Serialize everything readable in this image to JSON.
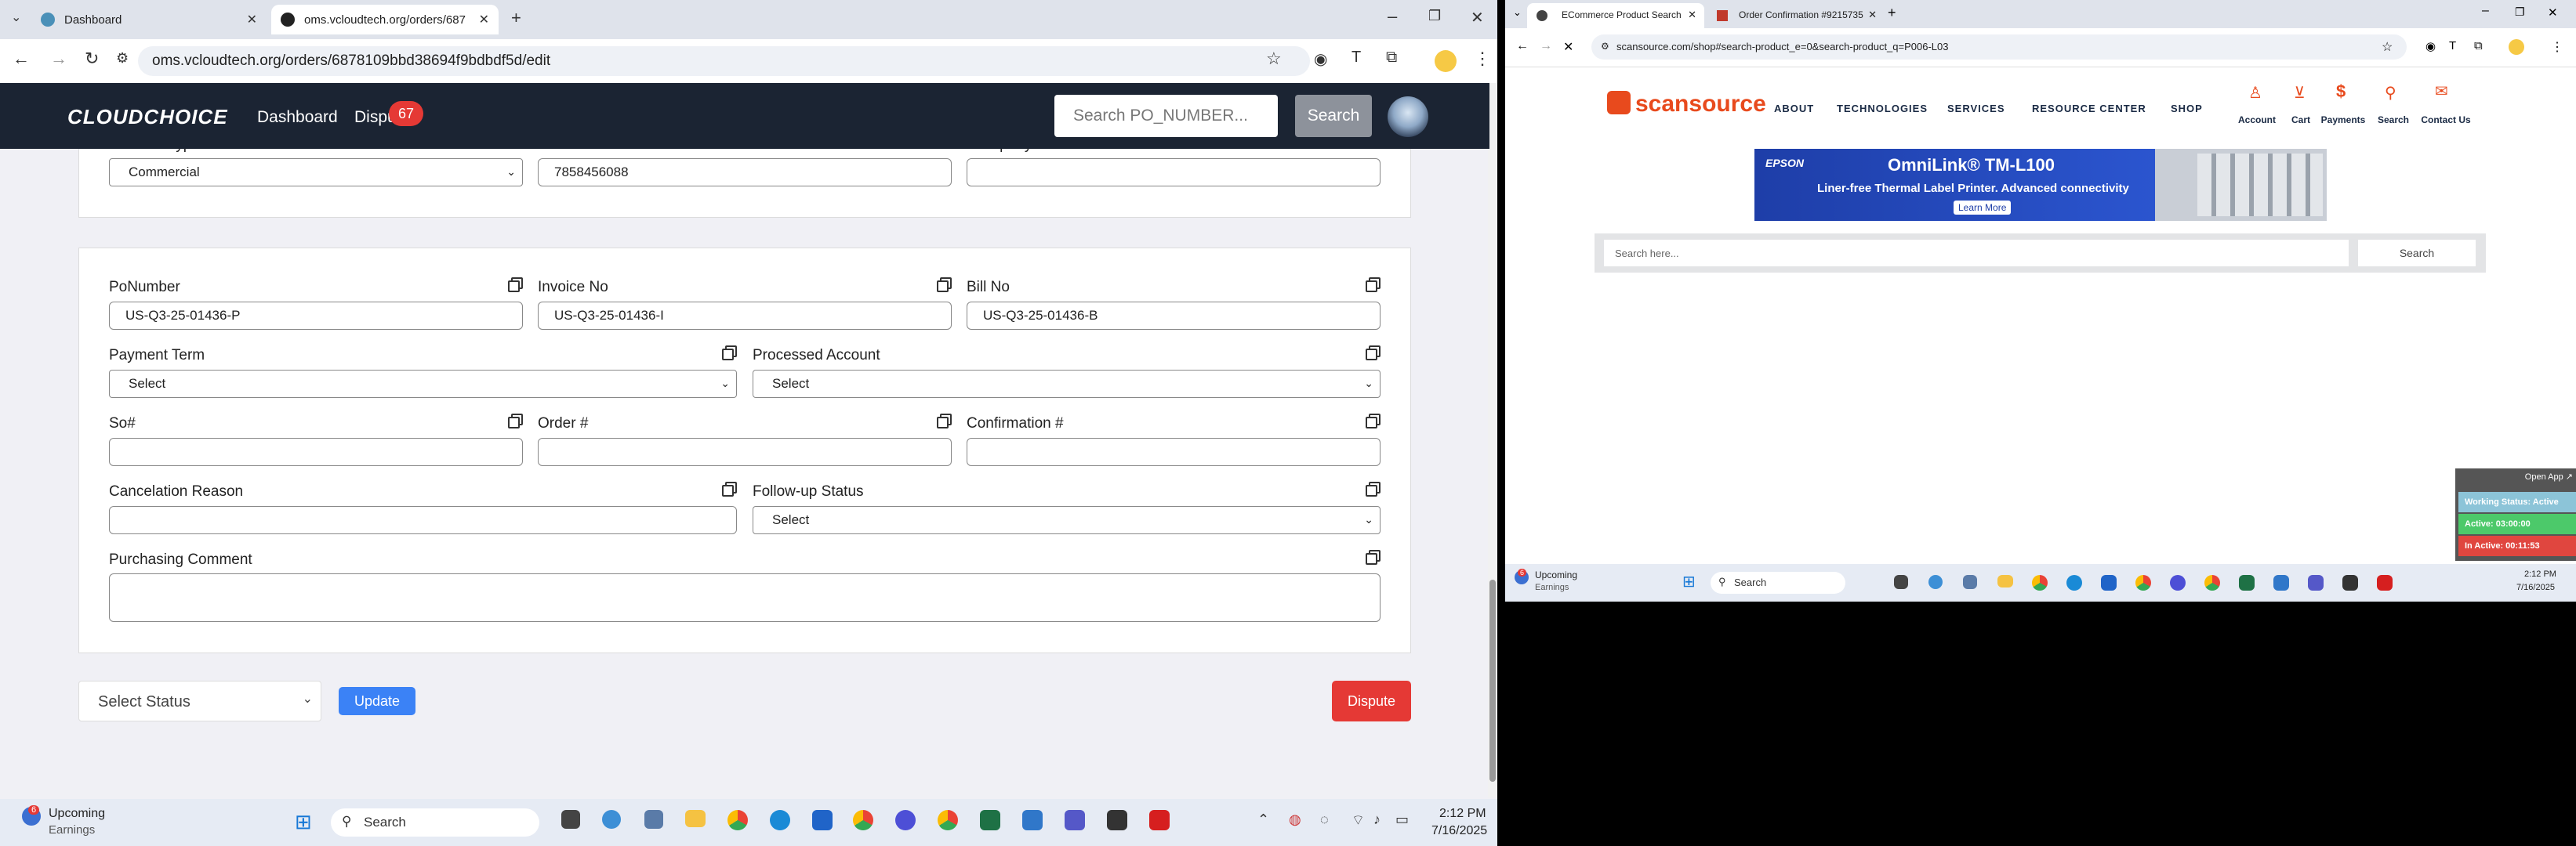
{
  "left_browser": {
    "tabs": [
      {
        "label": "Dashboard",
        "active": false
      },
      {
        "label": "oms.vcloudtech.org/orders/687",
        "active": true
      }
    ],
    "url": "oms.vcloudtech.org/orders/6878109bbd38694f9bdbdf5d/edit",
    "app": {
      "logo": "CLOUDCHOICE",
      "nav": [
        "Dashboard",
        "Dispu"
      ],
      "dispute_badge": "67",
      "search_placeholder": "Search PO_NUMBER...",
      "search_button": "Search"
    },
    "top_card": {
      "address_type_label": "Address Type",
      "address_type_value": "Commercial",
      "phone_label": "Phone Number",
      "phone_value": "7858456088",
      "company_phone_label": "Company Phone",
      "company_phone_value": ""
    },
    "form": {
      "po_label": "PoNumber",
      "po_value": "US-Q3-25-01436-P",
      "invoice_label": "Invoice No",
      "invoice_value": "US-Q3-25-01436-I",
      "bill_label": "Bill No",
      "bill_value": "US-Q3-25-01436-B",
      "payment_term_label": "Payment Term",
      "payment_term_value": "Select",
      "processed_account_label": "Processed Account",
      "processed_account_value": "Select",
      "so_label": "So#",
      "so_value": "",
      "order_label": "Order #",
      "order_value": "",
      "confirmation_label": "Confirmation #",
      "confirmation_value": "",
      "cancelation_label": "Cancelation Reason",
      "cancelation_value": "",
      "followup_label": "Follow-up Status",
      "followup_value": "Select",
      "comment_label": "Purchasing Comment",
      "comment_value": ""
    },
    "footer": {
      "status_select": "Select Status",
      "update_button": "Update",
      "dispute_button": "Dispute"
    },
    "taskbar": {
      "weather_badge": "6",
      "weather_title": "Upcoming",
      "weather_sub": "Earnings",
      "search": "Search",
      "time": "2:12 PM",
      "date": "7/16/2025"
    }
  },
  "right_browser": {
    "tabs": [
      {
        "label": "ECommerce Product Search",
        "active": true
      },
      {
        "label": "Order Confirmation #9215735",
        "active": false
      }
    ],
    "url": "scansource.com/shop#search-product_e=0&search-product_q=P006-L03",
    "site": {
      "logo": "scansource",
      "nav": [
        "ABOUT",
        "TECHNOLOGIES",
        "SERVICES",
        "RESOURCE CENTER",
        "SHOP"
      ],
      "icons": [
        "Account",
        "Cart",
        "Payments",
        "Search",
        "Contact Us"
      ],
      "banner_brand": "EPSON",
      "banner_title": "OmniLink® TM-L100",
      "banner_sub": "Liner-free Thermal Label Printer.  Advanced connectivity",
      "banner_link": "Learn More",
      "search_placeholder": "Search here...",
      "search_button": "Search"
    },
    "widget": {
      "open_app": "Open App ↗",
      "working": "Working Status: Active",
      "active": "Active: 03:00:00",
      "inactive": "In Active: 00:11:53"
    },
    "taskbar": {
      "weather_badge": "6",
      "weather_title": "Upcoming",
      "weather_sub": "Earnings",
      "search": "Search",
      "time": "2:12 PM",
      "date": "7/16/2025"
    }
  },
  "colors": {
    "nav_dark": "#1b2433",
    "update_blue": "#3b82f6",
    "dispute_red": "#e53935",
    "badge_red": "#e53935"
  }
}
